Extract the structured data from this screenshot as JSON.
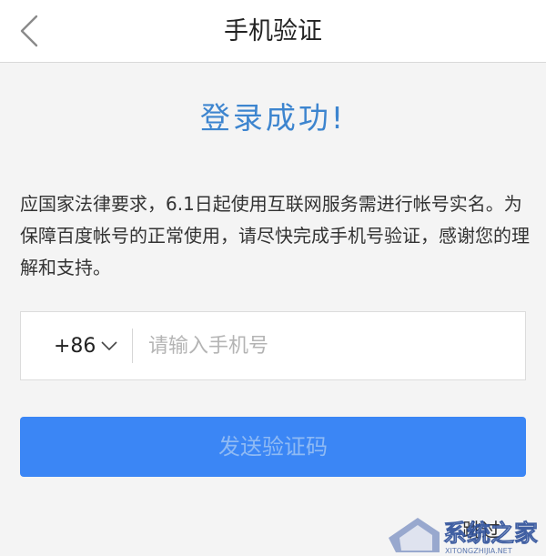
{
  "header": {
    "title": "手机验证",
    "back_icon": "chevron-left-icon"
  },
  "main": {
    "success_title": "登录成功!",
    "notice": "应国家法律要求，6.1日起使用互联网服务需进行帐号实名。为保障百度帐号的正常使用，请尽快完成手机号验证，感谢您的理解和支持。",
    "phone": {
      "country_code": "+86",
      "value": "",
      "placeholder": "请输入手机号"
    },
    "send_button_label": "发送验证码",
    "skip_label": "跳过"
  },
  "watermark": {
    "brand": "系统之家",
    "url": "XITONGZHIJIA.NET"
  },
  "colors": {
    "accent": "#3b86f5",
    "title_blue": "#3d85cf",
    "background": "#f4f4f4"
  }
}
